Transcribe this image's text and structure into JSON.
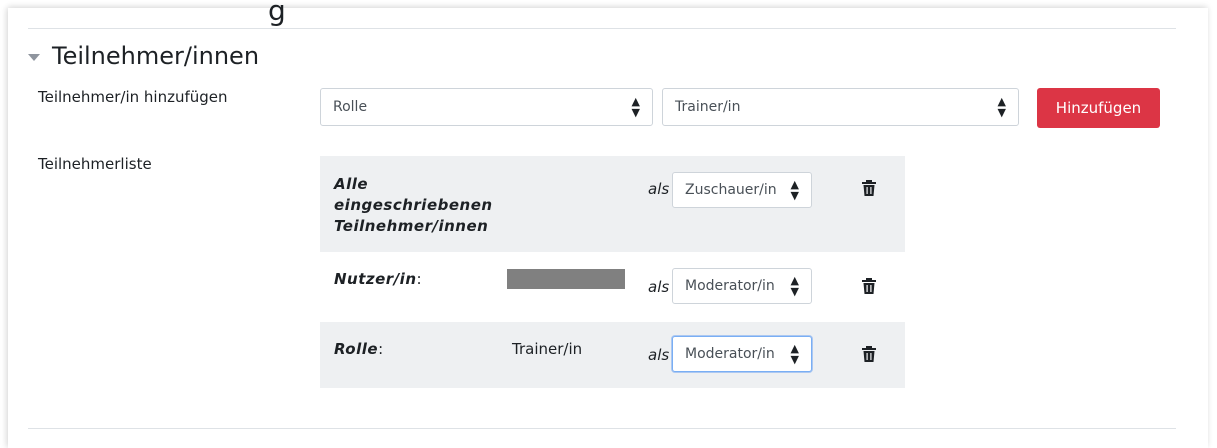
{
  "previous_section": {
    "title_fragment": "g"
  },
  "section": {
    "title": "Teilnehmer/innen"
  },
  "add_participant": {
    "label": "Teilnehmer/in hinzufügen",
    "type_select": "Rolle",
    "value_select": "Trainer/in",
    "button": "Hinzufügen"
  },
  "participant_list": {
    "label": "Teilnehmerliste",
    "connector": "als",
    "rows": [
      {
        "type": "Alle eingeschriebenen Teilnehmer/innen",
        "value": "",
        "role": "Zuschauer/in"
      },
      {
        "type": "Nutzer/in",
        "colon": ":",
        "value": "",
        "role": "Moderator/in"
      },
      {
        "type": "Rolle",
        "colon": ":",
        "value": "Trainer/in",
        "role": "Moderator/in"
      }
    ]
  },
  "colors": {
    "primary_button": "#dc3545",
    "row_alt": "#eef0f2",
    "focus_border": "#79aef4",
    "redacted": "#808080"
  },
  "icons": {
    "collapse": "caret-down-icon",
    "select_arrows": "sort-arrows-icon",
    "delete": "trash-icon"
  }
}
